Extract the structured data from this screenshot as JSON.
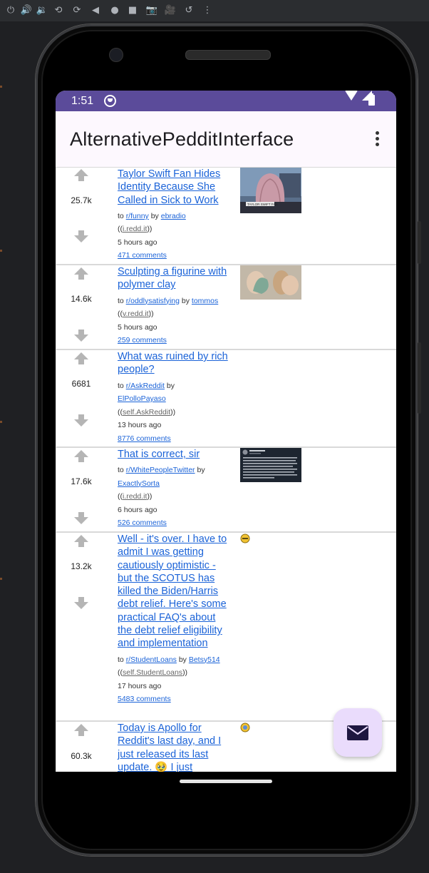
{
  "emulator_toolbar": {
    "icons": [
      "power-icon",
      "volume-up-icon",
      "volume-down-icon",
      "rotate-left-icon",
      "rotate-right-icon",
      "back-icon",
      "home-icon",
      "overview-icon",
      "screenshot-icon",
      "camera-record-icon",
      "reset-icon",
      "more-icon"
    ]
  },
  "statusbar": {
    "time": "1:51"
  },
  "appbar": {
    "title": "AlternativePedditInterface"
  },
  "posts": [
    {
      "score": "25.7k",
      "title": "Taylor Swift Fan Hides Identity Because She Called in Sick to Work",
      "to": "to ",
      "subreddit": "r/funny",
      "by": " by ",
      "author": "ebradio",
      "domain": "i.redd.it",
      "time": "5 hours ago",
      "comments": "471 comments",
      "thumb_caption": "TAYLOR SWIFT FAN"
    },
    {
      "score": "14.6k",
      "title": "Sculpting a figurine with polymer clay",
      "to": "to ",
      "subreddit": "r/oddlysatisfying",
      "by": " by ",
      "author": "tommos",
      "domain": "v.redd.it",
      "time": "5 hours ago",
      "comments": "259 comments"
    },
    {
      "score": "6681",
      "title": "What was ruined by rich people?",
      "to": "to ",
      "subreddit": "r/AskReddit",
      "by": " by ",
      "author": "ElPolloPayaso",
      "domain": "self.AskReddit",
      "time": "13 hours ago",
      "comments": "8776 comments"
    },
    {
      "score": "17.6k",
      "title": "That is correct, sir",
      "to": "to ",
      "subreddit": "r/WhitePeopleTwitter",
      "by": " by ",
      "author": "ExactlySorta",
      "domain": "i.redd.it",
      "time": "6 hours ago",
      "comments": "526 comments"
    },
    {
      "score": "13.2k",
      "title": "Well - it's over. I have to admit I was getting cautiously optimistic - but the SCOTUS has killed the Biden/Harris debt relief. Here's some practical FAQ's about the debt relief eligibility and implementation",
      "to": "to ",
      "subreddit": "r/StudentLoans",
      "by": " by ",
      "author": "Betsy514",
      "domain": "self.StudentLoans",
      "time": "17 hours ago",
      "comments": "5483 comments"
    },
    {
      "score": "60.3k",
      "title": "Today is Apollo for Reddit's last day, and I just released its last update. 🥹 I just"
    }
  ],
  "colors": {
    "statusbar": "#5b4b9a",
    "appbar": "#fdf8fe",
    "link": "#1b63d8",
    "fab": "#eadcfc"
  }
}
